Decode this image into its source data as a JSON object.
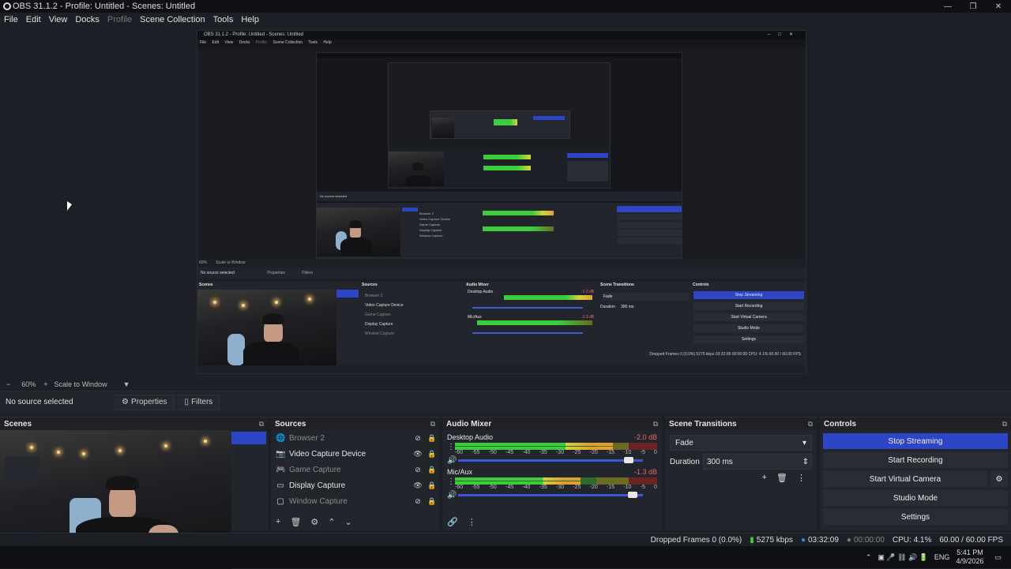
{
  "window": {
    "title": "OBS 31.1.2 - Profile: Untitled - Scenes: Untitled",
    "minimize": "—",
    "restore": "❐",
    "close": "✕"
  },
  "menu": [
    "File",
    "Edit",
    "View",
    "Docks",
    "Profile",
    "Scene Collection",
    "Tools",
    "Help"
  ],
  "nested_preview": {
    "title": "OBS 31.1.2 - Profile: Untitled - Scenes: Untitled",
    "menu": [
      "File",
      "Edit",
      "View",
      "Docks",
      "Profile",
      "Scene Collection",
      "Tools",
      "Help"
    ],
    "no_source": "No source selected",
    "zoom": "60%",
    "scale_mode": "Scale to Window",
    "properties": "Properties",
    "filters": "Filters",
    "scenes": "Scenes",
    "sources": "Sources",
    "audio_mixer": "Audio Mixer",
    "scene_transitions": "Scene Transitions",
    "controls": "Controls",
    "stop_streaming": "Stop Streaming",
    "start_recording": "Start Recording",
    "start_virtual_camera": "Start Virtual Camera",
    "studio_mode": "Studio Mode",
    "settings": "Settings",
    "source_items": [
      "Browser 2",
      "Video Capture Device",
      "Game Capture",
      "Display Capture",
      "Window Capture"
    ],
    "desktop_audio": "Desktop Audio",
    "mic_aux": "Mic/Aux",
    "desktop_db": "-2.0 dB",
    "mic_db": "-1.3 dB",
    "fade": "Fade",
    "duration_label": "Duration",
    "duration_value": "300 ms",
    "status": "Dropped Frames 0 (0.0%)   5275 kbps   03:32:09   00:00:00   CPU: 4.1%   60.00 / 60.00 FPS"
  },
  "preview_toolbar": {
    "zoom_out": "−",
    "zoom": "60%",
    "zoom_in": "+",
    "scale_mode": "Scale to Window",
    "dropdown": "▼"
  },
  "context": {
    "no_source": "No source selected",
    "properties": "Properties",
    "filters": "Filters",
    "gear_glyph": "⚙",
    "filter_glyph": "▯"
  },
  "scenes": {
    "title": "Scenes",
    "popout": "⧉"
  },
  "sources": {
    "title": "Sources",
    "popout": "⧉",
    "items": [
      {
        "label": "Browser 2",
        "icon": "🌐",
        "visible": false,
        "eye": "⊘",
        "lock": "🔒"
      },
      {
        "label": "Video Capture Device",
        "icon": "📷",
        "visible": true,
        "eye": "👁",
        "lock": "🔒"
      },
      {
        "label": "Game Capture",
        "icon": "🎮",
        "visible": false,
        "eye": "⊘",
        "lock": "🔒"
      },
      {
        "label": "Display Capture",
        "icon": "▭",
        "visible": true,
        "eye": "👁",
        "lock": "🔒"
      },
      {
        "label": "Window Capture",
        "icon": "▢",
        "visible": false,
        "eye": "⊘",
        "lock": "🔒"
      }
    ],
    "footer": {
      "add": "+",
      "remove": "🗑",
      "props": "⚙",
      "up": "⌃",
      "down": "⌄"
    }
  },
  "mixer": {
    "title": "Audio Mixer",
    "popout": "⧉",
    "scale": [
      "-60",
      "-55",
      "-50",
      "-45",
      "-40",
      "-35",
      "-30",
      "-25",
      "-20",
      "-15",
      "-10",
      "-5",
      "0"
    ],
    "channels": [
      {
        "name": "Desktop Audio",
        "db": "-2.0 dB",
        "level": 0.78,
        "volume": 0.95,
        "menu": "⋮",
        "speaker": "🔊"
      },
      {
        "name": "Mic/Aux",
        "db": "-1.3 dB",
        "level": 0.62,
        "volume": 0.97,
        "menu": "⋮",
        "speaker": "🔊"
      }
    ],
    "footer": {
      "link": "🔗",
      "menu": "⋮"
    }
  },
  "transitions": {
    "title": "Scene Transitions",
    "popout": "⧉",
    "selected": "Fade",
    "dropdown": "▾",
    "duration_label": "Duration",
    "duration_value": "300 ms",
    "spin": "⇕",
    "add": "+",
    "remove": "🗑",
    "menu": "⋮"
  },
  "controls": {
    "title": "Controls",
    "popout": "⧉",
    "stop_streaming": "Stop Streaming",
    "start_recording": "Start Recording",
    "start_virtual_camera": "Start Virtual Camera",
    "virtual_camera_settings": "⚙",
    "studio_mode": "Studio Mode",
    "settings": "Settings"
  },
  "status": {
    "dropped_frames": "Dropped Frames 0 (0.0%)",
    "bitrate": "5275 kbps",
    "bitrate_icon": "▮",
    "stream_time": "03:32:09",
    "stream_icon": "●",
    "record_time": "00:00:00",
    "record_icon": "●",
    "cpu": "CPU: 4.1%",
    "fps": "60.00 / 60.00 FPS"
  },
  "taskbar": {
    "chevron": "⌃",
    "language": "ENG",
    "time": "5:41 PM",
    "date": "4/9/2026",
    "notification": "▭",
    "tray_icons": "▣ 🎤 ⛓ 🔊 🔋"
  }
}
